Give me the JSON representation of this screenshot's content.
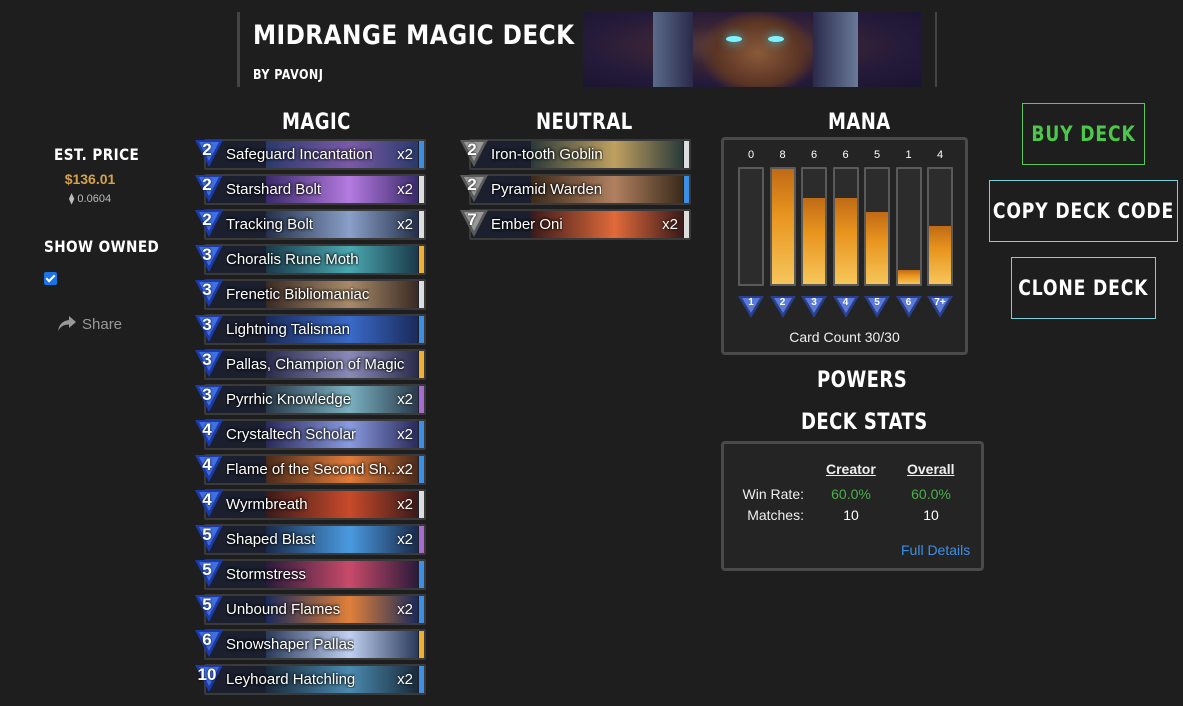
{
  "deck": {
    "title": "MIDRANGE MAGIC DECK",
    "author": "BY PAVONJ"
  },
  "sidebar": {
    "est_price_label": "EST. PRICE",
    "price": "$136.01",
    "eth_price": "⧫ 0.0604",
    "show_owned_label": "SHOW OWNED",
    "show_owned_checked": true,
    "share_label": "Share"
  },
  "columns": {
    "magic": "MAGIC",
    "neutral": "NEUTRAL",
    "mana": "MANA"
  },
  "magic_cards": [
    {
      "cost": "2",
      "name": "Safeguard Incantation",
      "qty": "x2",
      "rarity_color": "#3d8fe6",
      "art": [
        "#2a3a6a",
        "#7a5aa8"
      ]
    },
    {
      "cost": "2",
      "name": "Starshard Bolt",
      "qty": "x2",
      "rarity_color": "#dddddd",
      "art": [
        "#3a2a6a",
        "#b47ae0"
      ]
    },
    {
      "cost": "2",
      "name": "Tracking Bolt",
      "qty": "x2",
      "rarity_color": "#dddddd",
      "art": [
        "#24304a",
        "#8aa0c8"
      ]
    },
    {
      "cost": "3",
      "name": "Choralis Rune Moth",
      "qty": "",
      "rarity_color": "#f0b030",
      "art": [
        "#1a3a4a",
        "#4aa8b0"
      ]
    },
    {
      "cost": "3",
      "name": "Frenetic Bibliomaniac",
      "qty": "",
      "rarity_color": "#dddddd",
      "art": [
        "#3a2a24",
        "#a88a6a"
      ]
    },
    {
      "cost": "3",
      "name": "Lightning Talisman",
      "qty": "",
      "rarity_color": "#3d8fe6",
      "art": [
        "#1a2a5a",
        "#3a6ac8"
      ]
    },
    {
      "cost": "3",
      "name": "Pallas, Champion of Magic",
      "qty": "",
      "rarity_color": "#f0b030",
      "art": [
        "#2a2a4a",
        "#8a8ab8"
      ]
    },
    {
      "cost": "3",
      "name": "Pyrrhic Knowledge",
      "qty": "x2",
      "rarity_color": "#a66ad0",
      "art": [
        "#2a3a4a",
        "#7ab0c0"
      ]
    },
    {
      "cost": "4",
      "name": "Crystaltech Scholar",
      "qty": "x2",
      "rarity_color": "#3d8fe6",
      "art": [
        "#2a2a5a",
        "#8a9ae0"
      ]
    },
    {
      "cost": "4",
      "name": "Flame of the Second Sh...",
      "qty": "x2",
      "rarity_color": "#3d8fe6",
      "art": [
        "#4a2a1a",
        "#e07a3a"
      ]
    },
    {
      "cost": "4",
      "name": "Wyrmbreath",
      "qty": "x2",
      "rarity_color": "#dddddd",
      "art": [
        "#3a1a1a",
        "#c84a2a"
      ]
    },
    {
      "cost": "5",
      "name": "Shaped Blast",
      "qty": "x2",
      "rarity_color": "#a66ad0",
      "art": [
        "#1a2a4a",
        "#4a9ae0"
      ]
    },
    {
      "cost": "5",
      "name": "Stormstress",
      "qty": "",
      "rarity_color": "#3d8fe6",
      "art": [
        "#2a1a3a",
        "#c84a6a"
      ]
    },
    {
      "cost": "5",
      "name": "Unbound Flames",
      "qty": "x2",
      "rarity_color": "#3d8fe6",
      "art": [
        "#1a2a5a",
        "#e0803a"
      ]
    },
    {
      "cost": "6",
      "name": "Snowshaper Pallas",
      "qty": "",
      "rarity_color": "#f0b030",
      "art": [
        "#2a3a5a",
        "#c0d0f0"
      ]
    },
    {
      "cost": "10",
      "name": "Leyhoard Hatchling",
      "qty": "x2",
      "rarity_color": "#3d8fe6",
      "art": [
        "#1a2a3a",
        "#4a8ab0"
      ]
    }
  ],
  "neutral_cards": [
    {
      "cost": "2",
      "name": "Iron-tooth Goblin",
      "qty": "",
      "rarity_color": "#dddddd",
      "art": [
        "#2a3a3a",
        "#c0a060"
      ]
    },
    {
      "cost": "2",
      "name": "Pyramid Warden",
      "qty": "",
      "rarity_color": "#3d8fe6",
      "art": [
        "#3a2a1a",
        "#b08060"
      ]
    },
    {
      "cost": "7",
      "name": "Ember Oni",
      "qty": "x2",
      "rarity_color": "#dddddd",
      "art": [
        "#3a1a1a",
        "#e06a3a"
      ]
    }
  ],
  "mana": {
    "curve": [
      {
        "cost": "1",
        "count": 0
      },
      {
        "cost": "2",
        "count": 8
      },
      {
        "cost": "3",
        "count": 6
      },
      {
        "cost": "4",
        "count": 6
      },
      {
        "cost": "5",
        "count": 5
      },
      {
        "cost": "6",
        "count": 1
      },
      {
        "cost": "7+",
        "count": 4
      }
    ],
    "max_count": 8,
    "card_count_label": "Card Count 30/30"
  },
  "powers_label": "POWERS",
  "deck_stats": {
    "heading": "DECK STATS",
    "col_creator": "Creator",
    "col_overall": "Overall",
    "win_rate_label": "Win Rate:",
    "matches_label": "Matches:",
    "creator_win_rate": "60.0%",
    "overall_win_rate": "60.0%",
    "creator_matches": "10",
    "overall_matches": "10",
    "full_details": "Full Details"
  },
  "buttons": {
    "buy": "BUY DECK",
    "copy": "COPY DECK CODE",
    "clone": "CLONE DECK"
  }
}
